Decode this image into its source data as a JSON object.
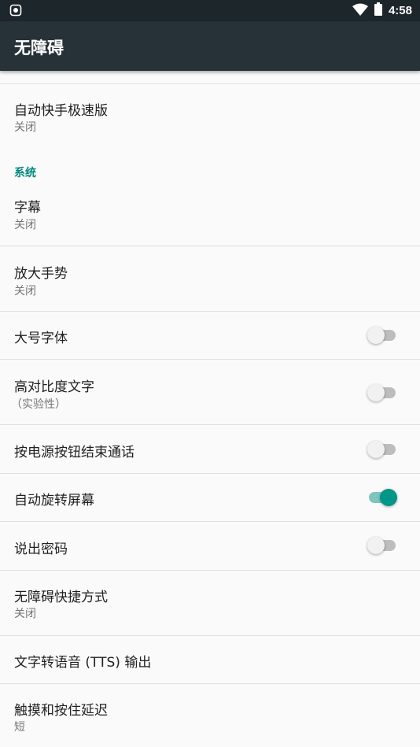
{
  "status_bar": {
    "time": "4:58",
    "icons": [
      "android-debug-icon",
      "wifi-icon",
      "battery-icon"
    ]
  },
  "app_bar": {
    "title": "无障碍"
  },
  "items": {
    "auto_kuaishou": {
      "title": "自动快手极速版",
      "subtitle": "关闭"
    },
    "section_system": "系统",
    "captions": {
      "title": "字幕",
      "subtitle": "关闭"
    },
    "magnification": {
      "title": "放大手势",
      "subtitle": "关闭"
    },
    "large_text": {
      "title": "大号字体",
      "enabled": false
    },
    "high_contrast": {
      "title": "高对比度文字",
      "subtitle": "（实验性）",
      "enabled": false
    },
    "power_ends_call": {
      "title": "按电源按钮结束通话",
      "enabled": false
    },
    "auto_rotate": {
      "title": "自动旋转屏幕",
      "enabled": true
    },
    "speak_passwords": {
      "title": "说出密码",
      "enabled": false
    },
    "accessibility_shortcut": {
      "title": "无障碍快捷方式",
      "subtitle": "关闭"
    },
    "tts_output": {
      "title": "文字转语音 (TTS) 输出"
    },
    "touch_hold_delay": {
      "title": "触摸和按住延迟",
      "subtitle": "短"
    }
  },
  "colors": {
    "accent": "#009688",
    "app_bar": "#263238",
    "status_bar": "#1d262b",
    "background": "#fafafa"
  }
}
